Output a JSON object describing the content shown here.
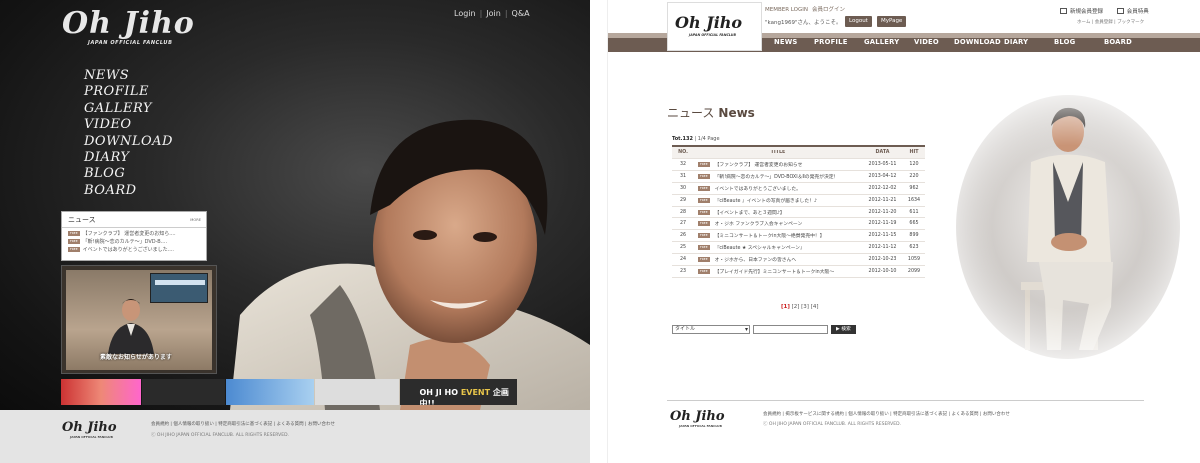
{
  "left": {
    "logo": "Oh Jiho",
    "logo_sub": "JAPAN OFFICIAL FANCLUB",
    "top_links": [
      "Login",
      "Join",
      "Q&A"
    ],
    "nav": [
      "NEWS",
      "PROFILE",
      "GALLERY",
      "VIDEO",
      "DOWNLOAD",
      "DIARY",
      "BLOG",
      "BOARD"
    ],
    "news_box": {
      "title": "ニュース",
      "more": "MORE",
      "tag": "FREE",
      "items": [
        "【ファンクラブ】 運営者変更のお知ら....",
        "「斬!病院～恋のカルテ～」DVD-B....",
        "イベントではありがとうございました...."
      ]
    },
    "video_caption": "素敵なお知らせがあります",
    "banner_text": {
      "prefix": "OH JI HO ",
      "highlight": "EVENT",
      "suffix": " 企画中!!"
    },
    "footer": {
      "logo": "Oh Jiho",
      "logo_sub": "JAPAN OFFICIAL FANCLUB",
      "links": "会員規約 | 個人情報の取り扱い | 特定商取引法に基づく表記 | よくある質問 | お問い合わせ",
      "copy": "ⓒ OH JIHO JAPAN OFFICIAL FANCLUB. ALL RIGHTS RESERVED."
    }
  },
  "right": {
    "logo": "Oh Jiho",
    "logo_sub": "JAPAN OFFICIAL FANCLUB",
    "member_login": "MEMBER LOGIN",
    "member_login_jp": "会員ログイン",
    "greeting": "\"kang1969\"さん、ようこそ。",
    "logout": "Logout",
    "mypage": "MyPage",
    "top_right": [
      "新規会員登録",
      "会員特典"
    ],
    "crumb": "ホーム | 会員登録 | ブックマーク",
    "nav": [
      "NEWS",
      "PROFILE",
      "GALLERY",
      "VIDEO",
      "DOWNLOAD",
      "DIARY",
      "BLOG",
      "BOARD"
    ],
    "title_jp": "ニュース",
    "title_en": "News",
    "total": {
      "label": "Tot.",
      "count": "132",
      "page": "1/4 Page"
    },
    "table": {
      "headers": {
        "no": "NO.",
        "title": "TITLE",
        "date": "DATA",
        "hit": "HIT"
      },
      "tag": "FREE",
      "rows": [
        {
          "no": "32",
          "title": "【ファンクラブ】 運営者変更のお知らせ",
          "date": "2013-05-11",
          "hit": "120"
        },
        {
          "no": "31",
          "title": "「斬!病院～恋のカルテ～」DVD-BOXⅠ＆Ⅱの発売が決定！",
          "date": "2013-04-12",
          "hit": "220"
        },
        {
          "no": "30",
          "title": "イベントではありがとうございました。",
          "date": "2012-12-02",
          "hit": "962"
        },
        {
          "no": "29",
          "title": "『ciBeaute 』イベントの写真が届きました！♪",
          "date": "2012-11-21",
          "hit": "1634"
        },
        {
          "no": "28",
          "title": "【イベントまで、あと３週間♪】",
          "date": "2012-11-20",
          "hit": "611"
        },
        {
          "no": "27",
          "title": "オ・ジホ ファンクラブ入会キャンペーン",
          "date": "2012-11-19",
          "hit": "665"
        },
        {
          "no": "26",
          "title": "【ミニコンサート＆トークin大阪～絶賛発売中！】",
          "date": "2012-11-15",
          "hit": "899"
        },
        {
          "no": "25",
          "title": "『ciBeaute ★ スペシャルキャンペーン』",
          "date": "2012-11-12",
          "hit": "623"
        },
        {
          "no": "24",
          "title": "オ・ジホから、日本ファンの皆さんへ",
          "date": "2012-10-23",
          "hit": "1059"
        },
        {
          "no": "23",
          "title": "【プレイガイド先行】ミニコンサート＆トークin大阪～",
          "date": "2012-10-10",
          "hit": "2099"
        }
      ]
    },
    "pager": [
      "[1]",
      "[2]",
      "[3]",
      "[4]"
    ],
    "search_option": "タイトル",
    "search_button": "▶ 検索",
    "footer": {
      "logo": "Oh Jiho",
      "logo_sub": "JAPAN OFFICIAL FANCLUB",
      "links": "会員規約 | 掲示板サービスに関する規約 | 個人情報の取り扱い | 特定商取引法に基づく表記 | よくある質問 | お問い合わせ",
      "copy": "ⓒ OH JIHO JAPAN OFFICIAL FANCLUB. ALL RIGHTS RESERVED."
    }
  }
}
